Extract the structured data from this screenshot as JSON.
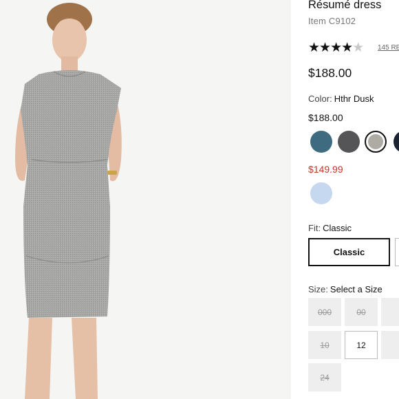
{
  "product": {
    "title": "Résumé dress",
    "item_number": "Item C9102",
    "rating_stars": "★★★★",
    "rating_partial_star": "★",
    "reviews_label": "145 RE",
    "price": "$188.00"
  },
  "color": {
    "label": "Color:",
    "selected_name": "Hthr Dusk",
    "regular_price": "$188.00",
    "sale_price": "$149.99",
    "regular_swatches": [
      {
        "name": "teal",
        "hex": "#3f6b80"
      },
      {
        "name": "charcoal",
        "hex": "#555558"
      },
      {
        "name": "hthr-dusk",
        "hex": "#aeaba4",
        "selected": true
      },
      {
        "name": "navy",
        "hex": "#1c2433"
      }
    ],
    "sale_swatches": [
      {
        "name": "light-blue",
        "hex": "#c6d8f0"
      }
    ]
  },
  "fit": {
    "label": "Fit:",
    "selected_name": "Classic",
    "options": [
      "Classic"
    ]
  },
  "size": {
    "label": "Size:",
    "prompt": "Select a Size",
    "options": [
      {
        "label": "000",
        "available": false
      },
      {
        "label": "00",
        "available": false
      },
      {
        "label": "10",
        "available": false
      },
      {
        "label": "12",
        "available": true
      },
      {
        "label": "24",
        "available": false
      }
    ]
  },
  "colors": {
    "accent_sale": "#c0392b",
    "text": "#111111"
  }
}
